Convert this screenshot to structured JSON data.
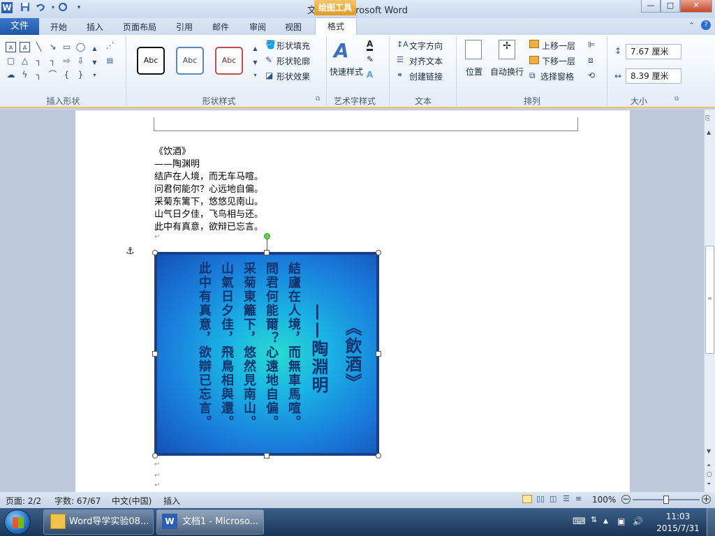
{
  "window": {
    "title": "文档1  -  Microsoft Word",
    "contextual_tab_group": "绘图工具",
    "controls": {
      "minimize": "—",
      "maximize": "□",
      "close": "✕"
    }
  },
  "quick_access": {
    "word_icon": "W",
    "save_icon": "save-icon",
    "undo_icon": "undo-icon",
    "redo_icon": "redo-icon",
    "customize_icon": "chevron-down-icon"
  },
  "tabs": [
    "文件",
    "开始",
    "插入",
    "页面布局",
    "引用",
    "邮件",
    "审阅",
    "视图",
    "格式"
  ],
  "ribbon": {
    "insert_shapes": {
      "label": "插入形状"
    },
    "shape_styles": {
      "label": "形状样式",
      "style_samples": [
        "Abc",
        "Abc",
        "Abc"
      ],
      "fill": "形状填充",
      "outline": "形状轮廓",
      "effects": "形状效果"
    },
    "wordart_styles": {
      "label": "艺术字样式",
      "quick_styles": "快速样式"
    },
    "text": {
      "label": "文本",
      "direction": "文字方向",
      "align": "对齐文本",
      "create_link": "创建链接"
    },
    "arrange": {
      "label": "排列",
      "position": "位置",
      "wrap": "自动换行",
      "bring_forward": "上移一层",
      "send_backward": "下移一层",
      "selection_pane": "选择窗格"
    },
    "size": {
      "label": "大小",
      "height": "7.67 厘米",
      "width": "8.39 厘米"
    }
  },
  "document": {
    "poem_lines": [
      "《饮酒》",
      "——陶渊明",
      "结庐在人境，而无车马喧。",
      "问君何能尔？心远地自偏。",
      "采菊东篱下，悠悠见南山。",
      "山气日夕佳，飞鸟相与还。",
      "此中有真意，欲辩已忘言。"
    ],
    "image_columns": [
      "《飲酒》",
      "——陶淵明",
      "結廬在人境，而無車馬喧。",
      "問君何能爾？心遠地自偏。",
      "采菊東籬下，悠然見南山。",
      "山氣日夕佳，飛鳥相與還。",
      "此中有真意，欲辯已忘言。"
    ]
  },
  "status_bar": {
    "page": "页面: 2/2",
    "words": "字数: 67/67",
    "language": "中文(中国)",
    "mode": "插入",
    "zoom": "100%"
  },
  "taskbar": {
    "items": [
      "Word导学实验08...",
      "文档1 - Microso..."
    ],
    "time": "11:03",
    "date": "2015/7/31"
  }
}
